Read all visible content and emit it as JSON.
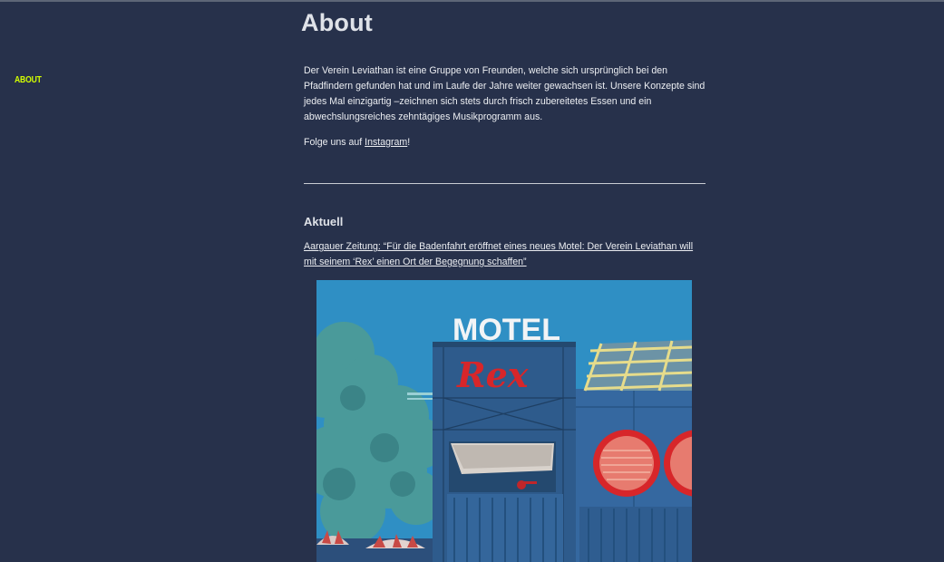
{
  "nav": {
    "about_label": "ABOUT",
    "accent_color": "#d4ff00"
  },
  "page": {
    "title": "About",
    "background_color": "#27314b"
  },
  "intro": {
    "text": "Der Verein Leviathan ist eine Gruppe von Freunden, welche sich ursprünglich bei den Pfadfindern gefunden hat und im Laufe der Jahre weiter gewachsen ist. Unsere Konzepte sind jedes Mal einzigartig –zeichnen sich stets durch frisch zubereitetes Essen und ein abwechslungsreiches zehntägiges Musikprogramm aus.",
    "follow_prefix": "Folge uns auf ",
    "instagram_link": "Instagram",
    "follow_suffix": "!"
  },
  "news": {
    "heading": "Aktuell",
    "article_link": "Aargauer Zeitung: “Für die Badenfahrt eröffnet eines neues Motel: Der Verein Leviathan will mit seinem ‘Rex’ einen Ort der Begegnung schaffen”"
  },
  "image": {
    "sign_text": "MOTEL",
    "script_text": "Rex"
  }
}
